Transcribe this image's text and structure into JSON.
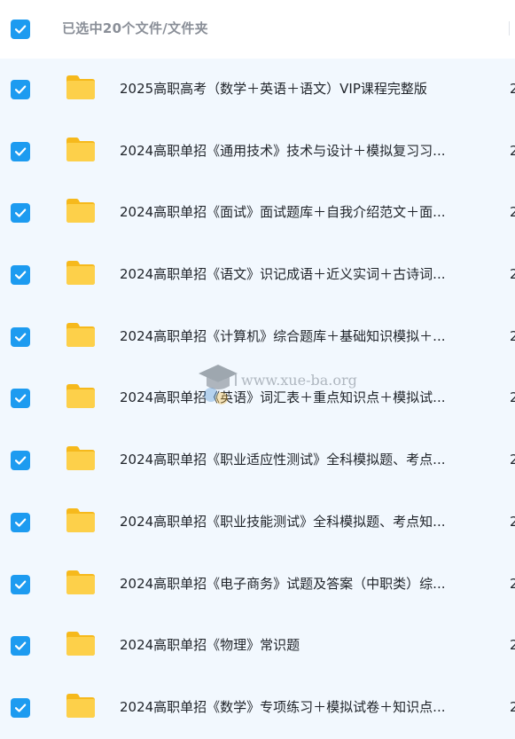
{
  "header": {
    "selection_text": "已选中20个文件/文件夹",
    "select_all_checked": true
  },
  "watermark": {
    "text": "www.xue-ba.org"
  },
  "colors": {
    "accent": "#1d9bf0",
    "folder": "#fbc02d",
    "row_background": "#f2f8fe"
  },
  "files": [
    {
      "name": "2025高职高考（数学＋英语＋语文）VIP课程完整版",
      "date_stub": "2",
      "checked": true,
      "icon": "folder-icon"
    },
    {
      "name": "2024高职单招《通用技术》技术与设计＋模拟复习习...",
      "date_stub": "2",
      "checked": true,
      "icon": "folder-icon"
    },
    {
      "name": "2024高职单招《面试》面试题库＋自我介绍范文＋面...",
      "date_stub": "2",
      "checked": true,
      "icon": "folder-icon"
    },
    {
      "name": "2024高职单招《语文》识记成语＋近义实词＋古诗词...",
      "date_stub": "2",
      "checked": true,
      "icon": "folder-icon"
    },
    {
      "name": "2024高职单招《计算机》综合题库＋基础知识模拟＋...",
      "date_stub": "2",
      "checked": true,
      "icon": "folder-icon"
    },
    {
      "name": "2024高职单招《英语》词汇表＋重点知识点＋模拟试...",
      "date_stub": "2",
      "checked": true,
      "icon": "folder-icon"
    },
    {
      "name": "2024高职单招《职业适应性测试》全科模拟题、考点...",
      "date_stub": "2",
      "checked": true,
      "icon": "folder-icon"
    },
    {
      "name": "2024高职单招《职业技能测试》全科模拟题、考点知...",
      "date_stub": "2",
      "checked": true,
      "icon": "folder-icon"
    },
    {
      "name": "2024高职单招《电子商务》试题及答案（中职类）综...",
      "date_stub": "2",
      "checked": true,
      "icon": "folder-icon"
    },
    {
      "name": "2024高职单招《物理》常识题",
      "date_stub": "2",
      "checked": true,
      "icon": "folder-icon"
    },
    {
      "name": "2024高职单招《数学》专项练习＋模拟试卷＋知识点...",
      "date_stub": "2",
      "checked": true,
      "icon": "folder-icon"
    }
  ]
}
